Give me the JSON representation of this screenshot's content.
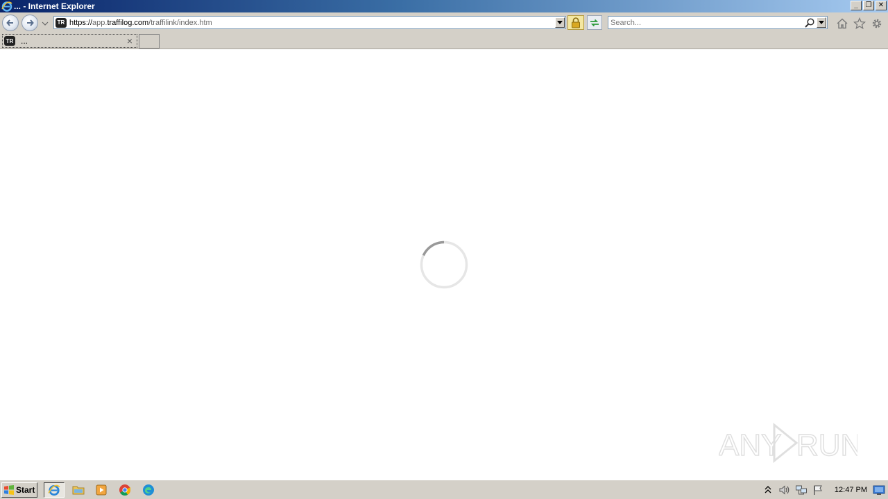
{
  "window": {
    "title": "... - Internet Explorer",
    "controls": {
      "minimize": "_",
      "maximize": "❐",
      "close": "✕"
    }
  },
  "navbar": {
    "address": {
      "scheme": "https://",
      "host_prefix": "app.",
      "host": "traffilog.com",
      "path": "/traffilink/index.htm",
      "site_icon_text": "TR"
    },
    "search": {
      "placeholder": "Search..."
    },
    "icons": [
      "back-icon",
      "forward-icon",
      "lock-icon",
      "refresh-icon",
      "search-icon",
      "home-icon",
      "favorites-icon",
      "tools-gear-icon"
    ]
  },
  "tabs": [
    {
      "title": "...",
      "site_icon_text": "TR",
      "close": "×"
    }
  ],
  "content": {
    "state": "loading",
    "watermark": "ANY RUN"
  },
  "taskbar": {
    "start_label": "Start",
    "apps": [
      "internet-explorer",
      "file-explorer",
      "media-player",
      "chrome",
      "edge"
    ],
    "clock": "12:47 PM"
  },
  "colors": {
    "title_gradient_start": "#0a246a",
    "title_gradient_end": "#a6caf0",
    "chrome_gray": "#d4d0c8",
    "spinner_track": "#e6e6e6",
    "spinner_arc": "#999999"
  }
}
